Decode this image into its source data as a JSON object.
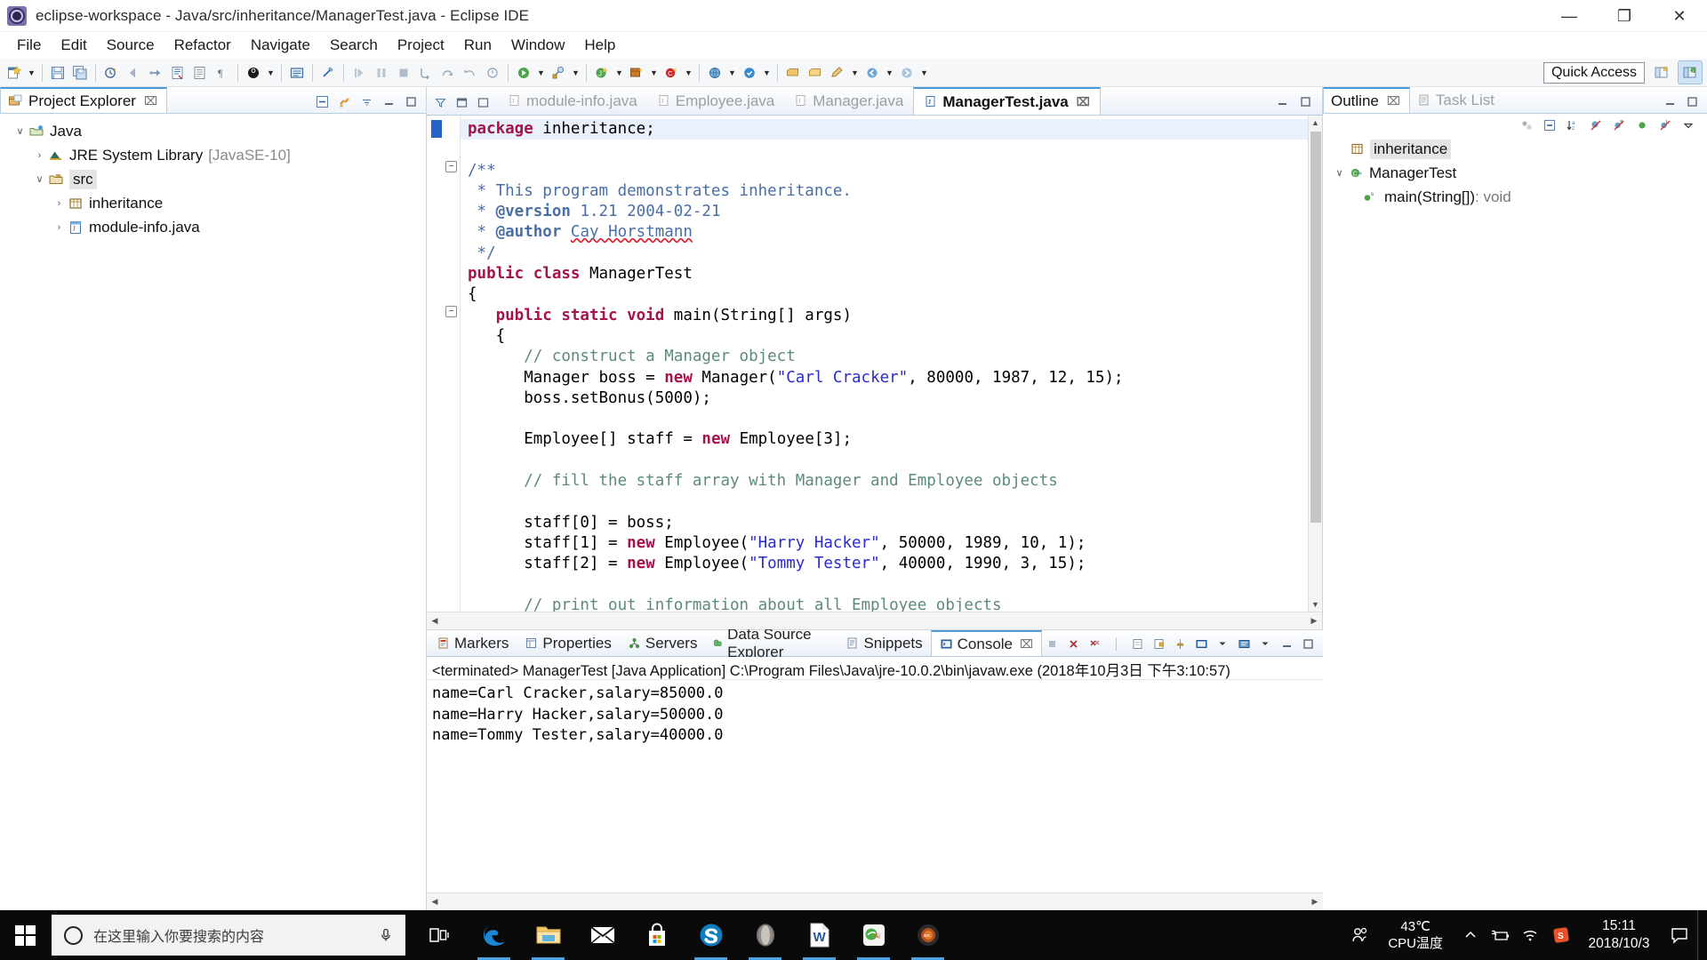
{
  "titlebar": {
    "title": "eclipse-workspace - Java/src/inheritance/ManagerTest.java - Eclipse IDE",
    "minimize": "—",
    "maximize": "❐",
    "close": "✕",
    "app_icon": "eclipse-icon"
  },
  "menubar": {
    "items": [
      {
        "label": "File"
      },
      {
        "label": "Edit"
      },
      {
        "label": "Source"
      },
      {
        "label": "Refactor"
      },
      {
        "label": "Navigate"
      },
      {
        "label": "Search"
      },
      {
        "label": "Project"
      },
      {
        "label": "Run"
      },
      {
        "label": "Window"
      },
      {
        "label": "Help"
      }
    ]
  },
  "toolbar": {
    "quick_access": "Quick Access",
    "perspective_java": "java-perspective-button",
    "perspective_other": "open-perspective-button"
  },
  "project_explorer": {
    "title": "Project Explorer",
    "close_glyph": "⌧",
    "tools": [
      "collapse-all-icon",
      "link-with-editor-icon",
      "view-menu-icon",
      "minimize-icon",
      "maximize-icon"
    ],
    "tree": [
      {
        "label": "Java",
        "indent": 0,
        "twist": "∨",
        "icon": "java-project-icon",
        "selected": false,
        "dim": ""
      },
      {
        "label": "JRE System Library",
        "indent": 1,
        "twist": "›",
        "icon": "library-icon",
        "selected": false,
        "dim": "[JavaSE-10]"
      },
      {
        "label": "src",
        "indent": 1,
        "twist": "∨",
        "icon": "source-folder-icon",
        "selected": true,
        "dim": ""
      },
      {
        "label": "inheritance",
        "indent": 2,
        "twist": "›",
        "icon": "package-icon",
        "selected": false,
        "dim": ""
      },
      {
        "label": "module-info.java",
        "indent": 2,
        "twist": "›",
        "icon": "java-file-icon",
        "selected": false,
        "dim": ""
      }
    ]
  },
  "editor": {
    "tabs": [
      {
        "label": "module-info.java",
        "active": false,
        "icon": "java-file-icon"
      },
      {
        "label": "Employee.java",
        "active": false,
        "icon": "java-file-icon"
      },
      {
        "label": "Manager.java",
        "active": false,
        "icon": "java-file-icon"
      },
      {
        "label": "ManagerTest.java",
        "active": true,
        "icon": "java-file-icon"
      }
    ],
    "close_glyph": "⌧",
    "code_lines": [
      {
        "n": 1,
        "highlight": true,
        "fold": "",
        "segments": [
          {
            "t": "package ",
            "c": "kw"
          },
          {
            "t": "inheritance;",
            "c": ""
          }
        ]
      },
      {
        "n": 2,
        "highlight": false,
        "fold": "",
        "segments": []
      },
      {
        "n": 3,
        "highlight": false,
        "fold": "minus",
        "segments": [
          {
            "t": "/**",
            "c": "jd"
          }
        ]
      },
      {
        "n": 4,
        "highlight": false,
        "fold": "",
        "segments": [
          {
            "t": " * This program demonstrates inheritance.",
            "c": "jd"
          }
        ]
      },
      {
        "n": 5,
        "highlight": false,
        "fold": "",
        "segments": [
          {
            "t": " * ",
            "c": "jd"
          },
          {
            "t": "@version",
            "c": "jdtag"
          },
          {
            "t": " 1.21 2004-02-21",
            "c": "jd"
          }
        ]
      },
      {
        "n": 6,
        "highlight": false,
        "fold": "",
        "segments": [
          {
            "t": " * ",
            "c": "jd"
          },
          {
            "t": "@author",
            "c": "jdtag"
          },
          {
            "t": " ",
            "c": "jd"
          },
          {
            "t": "Cay Horstmann",
            "c": "jd sq"
          }
        ]
      },
      {
        "n": 7,
        "highlight": false,
        "fold": "",
        "segments": [
          {
            "t": " */",
            "c": "jd"
          }
        ]
      },
      {
        "n": 8,
        "highlight": false,
        "fold": "",
        "segments": [
          {
            "t": "public class ",
            "c": "kw"
          },
          {
            "t": "ManagerTest",
            "c": ""
          }
        ]
      },
      {
        "n": 9,
        "highlight": false,
        "fold": "",
        "segments": [
          {
            "t": "{",
            "c": ""
          }
        ]
      },
      {
        "n": 10,
        "highlight": false,
        "fold": "minus",
        "segments": [
          {
            "t": "   ",
            "c": ""
          },
          {
            "t": "public static void ",
            "c": "kw"
          },
          {
            "t": "main(String[] args)",
            "c": ""
          }
        ]
      },
      {
        "n": 11,
        "highlight": false,
        "fold": "",
        "segments": [
          {
            "t": "   {",
            "c": ""
          }
        ]
      },
      {
        "n": 12,
        "highlight": false,
        "fold": "",
        "segments": [
          {
            "t": "      // construct a Manager object",
            "c": "cm"
          }
        ]
      },
      {
        "n": 13,
        "highlight": false,
        "fold": "",
        "segments": [
          {
            "t": "      Manager boss = ",
            "c": ""
          },
          {
            "t": "new ",
            "c": "kw"
          },
          {
            "t": "Manager(",
            "c": ""
          },
          {
            "t": "\"Carl Cracker\"",
            "c": "str"
          },
          {
            "t": ", 80000, 1987, 12, 15);",
            "c": ""
          }
        ]
      },
      {
        "n": 14,
        "highlight": false,
        "fold": "",
        "segments": [
          {
            "t": "      boss.setBonus(5000);",
            "c": ""
          }
        ]
      },
      {
        "n": 15,
        "highlight": false,
        "fold": "",
        "segments": []
      },
      {
        "n": 16,
        "highlight": false,
        "fold": "",
        "segments": [
          {
            "t": "      Employee[] staff = ",
            "c": ""
          },
          {
            "t": "new ",
            "c": "kw"
          },
          {
            "t": "Employee[3];",
            "c": ""
          }
        ]
      },
      {
        "n": 17,
        "highlight": false,
        "fold": "",
        "segments": []
      },
      {
        "n": 18,
        "highlight": false,
        "fold": "",
        "segments": [
          {
            "t": "      // fill the staff array with Manager and Employee objects",
            "c": "cm"
          }
        ]
      },
      {
        "n": 19,
        "highlight": false,
        "fold": "",
        "segments": []
      },
      {
        "n": 20,
        "highlight": false,
        "fold": "",
        "segments": [
          {
            "t": "      staff[0] = boss;",
            "c": ""
          }
        ]
      },
      {
        "n": 21,
        "highlight": false,
        "fold": "",
        "segments": [
          {
            "t": "      staff[1] = ",
            "c": ""
          },
          {
            "t": "new ",
            "c": "kw"
          },
          {
            "t": "Employee(",
            "c": ""
          },
          {
            "t": "\"Harry Hacker\"",
            "c": "str"
          },
          {
            "t": ", 50000, 1989, 10, 1);",
            "c": ""
          }
        ]
      },
      {
        "n": 22,
        "highlight": false,
        "fold": "",
        "segments": [
          {
            "t": "      staff[2] = ",
            "c": ""
          },
          {
            "t": "new ",
            "c": "kw"
          },
          {
            "t": "Employee(",
            "c": ""
          },
          {
            "t": "\"Tommy Tester\"",
            "c": "str"
          },
          {
            "t": ", 40000, 1990, 3, 15);",
            "c": ""
          }
        ]
      },
      {
        "n": 23,
        "highlight": false,
        "fold": "",
        "segments": []
      },
      {
        "n": 24,
        "highlight": false,
        "fold": "",
        "segments": [
          {
            "t": "      // print out information about all Employee objects",
            "c": "cm"
          }
        ]
      }
    ]
  },
  "console_panel": {
    "tabs": [
      {
        "label": "Markers",
        "active": false,
        "icon": "markers-icon"
      },
      {
        "label": "Properties",
        "active": false,
        "icon": "properties-icon"
      },
      {
        "label": "Servers",
        "active": false,
        "icon": "servers-icon"
      },
      {
        "label": "Data Source Explorer",
        "active": false,
        "icon": "datasource-icon"
      },
      {
        "label": "Snippets",
        "active": false,
        "icon": "snippets-icon"
      },
      {
        "label": "Console",
        "active": true,
        "icon": "console-icon"
      }
    ],
    "close_glyph": "⌧",
    "header": "<terminated> ManagerTest [Java Application] C:\\Program Files\\Java\\jre-10.0.2\\bin\\javaw.exe (2018年10月3日 下午3:10:57)",
    "output": [
      "name=Carl Cracker,salary=85000.0",
      "name=Harry Hacker,salary=50000.0",
      "name=Tommy Tester,salary=40000.0"
    ]
  },
  "outline": {
    "tabs": [
      {
        "label": "Outline",
        "active": true,
        "icon": "outline-icon"
      },
      {
        "label": "Task List",
        "active": false,
        "icon": "tasklist-icon"
      }
    ],
    "close_glyph": "⌧",
    "tools": [
      "focus-icon",
      "collapse-all-icon",
      "sort-icon",
      "hide-fields-icon",
      "hide-static-icon",
      "hide-nonpublic-icon",
      "hide-local-icon",
      "view-menu-icon"
    ],
    "tree": [
      {
        "label": "inheritance",
        "indent": 0,
        "twist": "",
        "icon": "package-icon",
        "selected": true,
        "sub": ""
      },
      {
        "label": "ManagerTest",
        "indent": 0,
        "twist": "∨",
        "icon": "class-icon",
        "selected": false,
        "sub": ""
      },
      {
        "label": "main(String[])",
        "indent": 1,
        "twist": "",
        "icon": "method-static-icon",
        "selected": false,
        "sub": " : void"
      }
    ]
  },
  "taskbar": {
    "start": "windows-start-icon",
    "search_placeholder": "在这里输入你要搜索的内容",
    "cortana_icon": "cortana-icon",
    "mic_icon": "microphone-icon",
    "apps": [
      {
        "name": "task-view-icon",
        "running": false
      },
      {
        "name": "edge-icon",
        "running": true
      },
      {
        "name": "file-explorer-icon",
        "running": true
      },
      {
        "name": "mail-icon",
        "running": false
      },
      {
        "name": "microsoft-store-icon",
        "running": false
      },
      {
        "name": "skype-icon",
        "running": true
      },
      {
        "name": "opera-icon",
        "running": true
      },
      {
        "name": "word-icon",
        "running": true
      },
      {
        "name": "taobao-icon",
        "running": true
      },
      {
        "name": "eclipse-taskbar-icon",
        "running": true
      }
    ],
    "people_icon": "people-icon",
    "cpu_temp": "43℃",
    "cpu_label": "CPU温度",
    "tray": [
      "show-hidden-icons",
      "power-battery-icon",
      "network-icon",
      "sogou-input-icon"
    ],
    "time": "15:11",
    "date": "2018/10/3",
    "notifications": "action-center-icon"
  },
  "colors": {
    "accent_blue": "#4a9bd8",
    "keyword": "#a5134f",
    "string": "#2a2ad0",
    "comment": "#5d8a7a",
    "javadoc": "#4a6fa5",
    "taskbar_bg": "#0a0a0a"
  }
}
